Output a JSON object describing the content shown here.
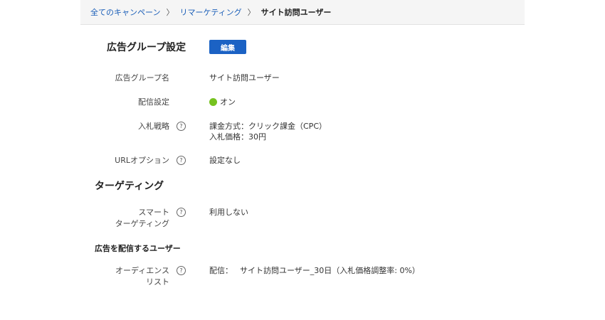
{
  "breadcrumb": {
    "items": [
      "全てのキャンペーン",
      "リマーケティング"
    ],
    "separator": "〉",
    "current": "サイト訪問ユーザー"
  },
  "settings": {
    "title": "広告グループ設定",
    "edit_label": "編集",
    "rows": {
      "name": {
        "label": "広告グループ名",
        "value": "サイト訪問ユーザー"
      },
      "delivery": {
        "label": "配信設定",
        "value": "オン",
        "status_color": "#76c21f"
      },
      "bidding": {
        "label": "入札戦略",
        "line1": "課金方式：クリック課金（CPC）",
        "line2": "入札価格：30円"
      },
      "url": {
        "label": "URLオプション",
        "value": "設定なし"
      }
    }
  },
  "targeting": {
    "title": "ターゲティング",
    "smart": {
      "label_line1": "スマート",
      "label_line2": "ターゲティング",
      "value": "利用しない"
    }
  },
  "audience": {
    "title": "広告を配信するユーザー",
    "list": {
      "label_line1": "オーディエンス",
      "label_line2": "リスト",
      "prefix": "配信：",
      "value": "サイト訪問ユーザー_30日（入札価格調整率: 0%）"
    }
  },
  "help_glyph": "?",
  "colors": {
    "link": "#1a5eb8",
    "button": "#1b62c4",
    "on_status": "#76c21f"
  }
}
